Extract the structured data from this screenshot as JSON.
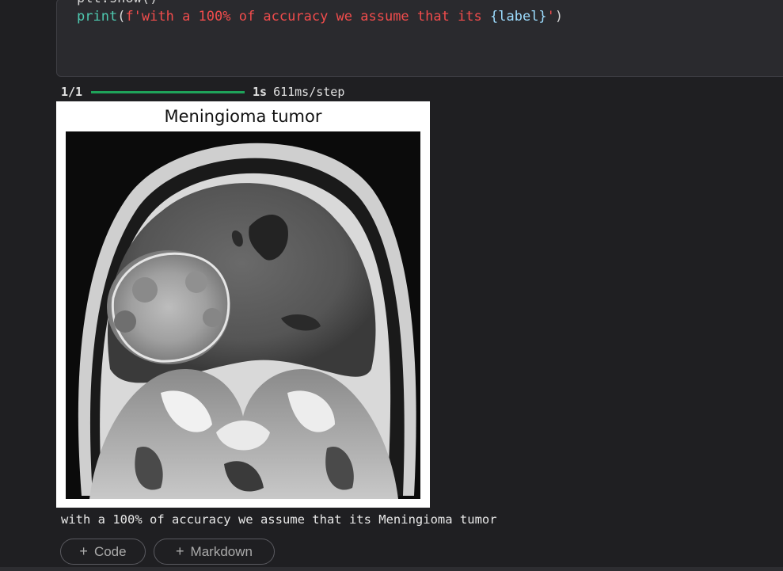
{
  "code_cell": {
    "prev_line": "plt.show()",
    "print_func": "print",
    "print_open": "(",
    "print_prefix": "f'with a 100% of accuracy we assume that its ",
    "print_var": "{label}",
    "print_suffix": "'",
    "print_close": ")"
  },
  "progress": {
    "count": "1/1",
    "time": "1s",
    "step": "611ms/step",
    "fraction": 1.0
  },
  "figure": {
    "title": "Meningioma tumor",
    "image_subject": "brain MRI coronal scan"
  },
  "output": {
    "text": "with a 100% of accuracy we assume that its Meningioma tumor"
  },
  "buttons": {
    "code_label": "Code",
    "markdown_label": "Markdown"
  },
  "colors": {
    "background": "#1f1f22",
    "cell_bg": "#2a2a2e",
    "progress": "#1fa35a",
    "string": "#f14c4c"
  }
}
